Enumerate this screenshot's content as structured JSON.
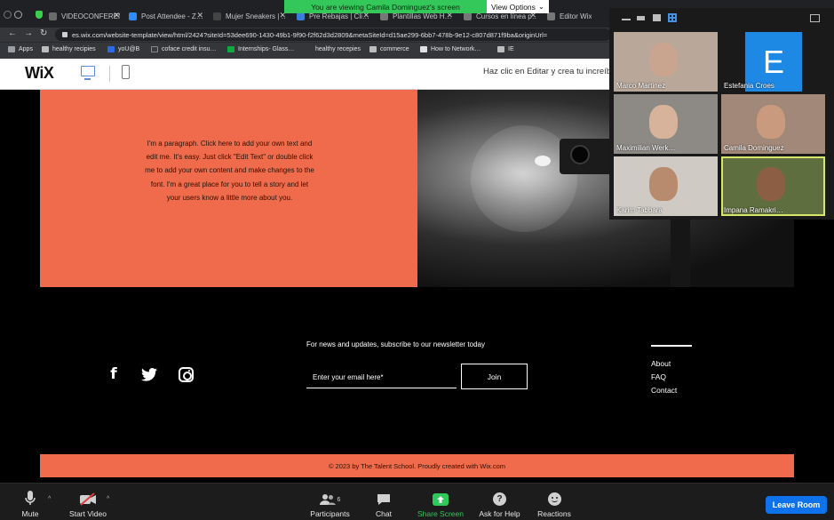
{
  "browser": {
    "tabs": [
      {
        "label": "VIDEOCONFEREN…",
        "color": "#6b6b6b"
      },
      {
        "label": "Post Attendee - Z…",
        "color": "#2d8cff"
      },
      {
        "label": "Mujer Sneakers | …",
        "color": "#444444"
      },
      {
        "label": "Pre Rebajas | Cli…",
        "color": "#3b7dd8"
      },
      {
        "label": "Plantillas Web H…",
        "color": "#777777"
      },
      {
        "label": "Cursos en línea p…",
        "color": "#777777"
      },
      {
        "label": "Editor Wix",
        "color": "#777777"
      }
    ],
    "url": "es.wix.com/website-template/view/html/2424?siteId=53dee690-1430-49b1-9f90-f2f62d3d2809&metaSiteId=d15ae299-6bb7-478b-9e12-c807d871f9ba&originUrl=",
    "bookmarks": [
      "Apps",
      "healthy recipies",
      "yoU@B",
      "coface credit insu…",
      "Internships- Glass…",
      "healthy recepies",
      "commerce",
      "How to Network…",
      "IE"
    ]
  },
  "share_banner": {
    "text": "You are viewing Camila Dominguez's screen",
    "view_options": "View Options"
  },
  "wix": {
    "logo": "WiX",
    "edit_message": "Haz clic en Editar y crea tu increíble"
  },
  "page": {
    "paragraph": "I'm a paragraph. Click here to add your own text and edit me. It's easy. Just click \"Edit Text\" or double click me to add your own content and make changes to the font. I'm a great place for you to tell a story and let your users know a little more about you.",
    "newsletter": "For news and updates, subscribe to our newsletter today",
    "email_placeholder": "Enter your email here*",
    "join": "Join",
    "links": [
      "About",
      "FAQ",
      "Contact"
    ],
    "copyright": "© 2023 by The Talent School. Proudly created with Wix.com",
    "accent": "#ef6b4b"
  },
  "participants_tiles": [
    {
      "name": "Marco Martinez",
      "bg": "#b9a79a",
      "skin": "#c9a48e"
    },
    {
      "name": "Estefania Croes",
      "avatar_letter": "E",
      "avatar_color": "#1e88e5"
    },
    {
      "name": "Maximilian Werk…",
      "bg": "#8d8a86",
      "skin": "#d7b39c"
    },
    {
      "name": "Camila Dominguez",
      "bg": "#a28878",
      "skin": "#c99a7e"
    },
    {
      "name": "Karim Tabbara",
      "bg": "#cfcac4",
      "skin": "#b88b6f"
    },
    {
      "name": "Impana Ramakri…",
      "bg": "#5f6e3e",
      "skin": "#8c5f44",
      "active": true
    }
  ],
  "toolbar": {
    "mute": "Mute",
    "start_video": "Start Video",
    "participants": "Participants",
    "participants_count": "6",
    "chat": "Chat",
    "share_screen": "Share Screen",
    "ask_for_help": "Ask for Help",
    "reactions": "Reactions",
    "leave_room": "Leave Room"
  }
}
